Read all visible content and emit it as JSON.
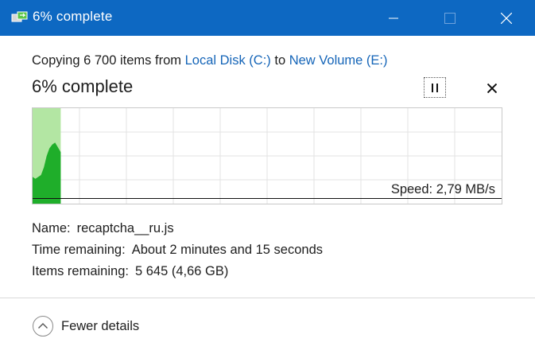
{
  "window": {
    "title": "6% complete",
    "accent": "#0d68c2"
  },
  "header": {
    "prefix": "Copying 6 700 items from ",
    "source": "Local Disk (C:)",
    "middle": " to ",
    "destination": "New Volume (E:)",
    "percent": "6% complete"
  },
  "graph": {
    "speed_text": "Speed: 2,79 MB/s",
    "progress": 0.06,
    "fill_color": "#b3e6a3",
    "curve_color": "#1fae2a"
  },
  "details": {
    "name_label": "Name:",
    "name_value": "recaptcha__ru.js",
    "time_label": "Time remaining:",
    "time_value": "About 2 minutes and 15 seconds",
    "items_label": "Items remaining:",
    "items_value": "5 645 (4,66 GB)"
  },
  "footer": {
    "toggle_label": "Fewer details"
  },
  "icons": {
    "title": "copy-transfer-icon",
    "pause": "pause-icon",
    "cancel": "close-icon",
    "toggle": "chevron-up-icon"
  }
}
